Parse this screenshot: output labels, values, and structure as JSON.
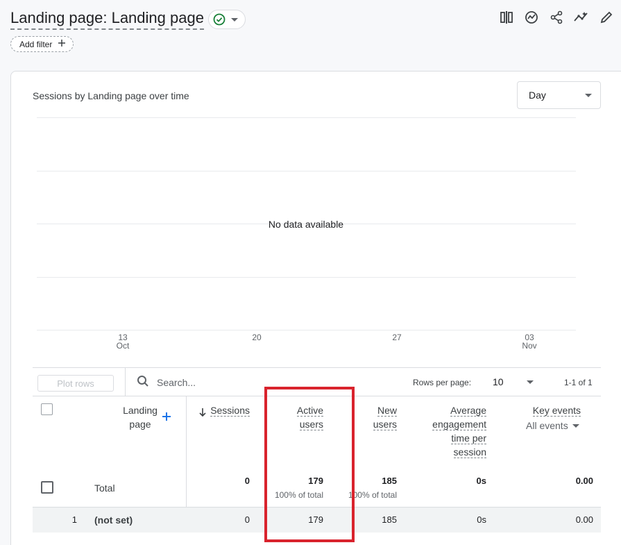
{
  "header": {
    "title": "Landing page: Landing page",
    "add_filter_label": "Add filter",
    "toolbar_icons": [
      "compare-icon",
      "insights-icon",
      "share-icon",
      "trend-icon",
      "edit-icon"
    ]
  },
  "chart": {
    "title": "Sessions by Landing page over time",
    "granularity": "Day",
    "empty_message": "No data available",
    "x_ticks": [
      {
        "day": "13",
        "month": "Oct"
      },
      {
        "day": "20",
        "month": ""
      },
      {
        "day": "27",
        "month": ""
      },
      {
        "day": "03",
        "month": "Nov"
      }
    ]
  },
  "table_toolbar": {
    "plot_rows_label": "Plot rows",
    "search_placeholder": "Search...",
    "rows_per_page_label": "Rows per page:",
    "rows_per_page_value": "10",
    "pagination": "1-1 of 1"
  },
  "table": {
    "columns": {
      "landing_page": [
        "Landing",
        "page"
      ],
      "sessions": "Sessions",
      "active_users": [
        "Active",
        "users"
      ],
      "new_users": [
        "New",
        "users"
      ],
      "avg_engagement": [
        "Average",
        "engagement",
        "time per",
        "session"
      ],
      "key_events": "Key events",
      "key_events_filter": "All events"
    },
    "total": {
      "label": "Total",
      "sessions": "0",
      "active_users": "179",
      "active_users_pct": "100% of total",
      "new_users": "185",
      "new_users_pct": "100% of total",
      "avg_engagement": "0s",
      "key_events": "0.00"
    },
    "rows": [
      {
        "index": "1",
        "landing_page": "(not set)",
        "sessions": "0",
        "active_users": "179",
        "new_users": "185",
        "avg_engagement": "0s",
        "key_events": "0.00"
      }
    ]
  },
  "colors": {
    "highlight": "#d9232d",
    "accent": "#1a73e8",
    "success": "#188038"
  }
}
